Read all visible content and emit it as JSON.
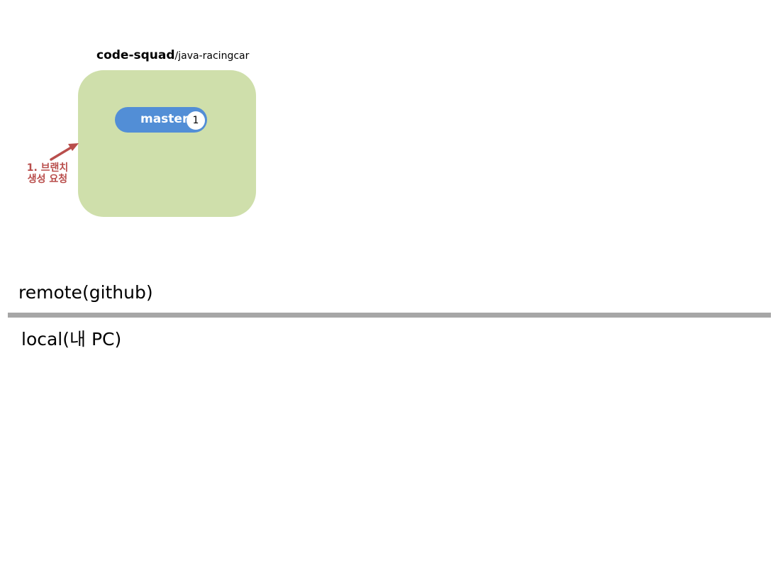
{
  "colors": {
    "repo_box": "#cfdfab",
    "branch_pill": "#528ed6",
    "annotation": "#b94e4c",
    "divider": "#a6a6a6"
  },
  "repo": {
    "owner": "code-squad",
    "separator": "/",
    "name": "java-racingcar",
    "branch": {
      "label": "master",
      "commit_count": "1"
    }
  },
  "annotation": {
    "line1": "1. 브랜치",
    "line2": "생성 요청"
  },
  "zones": {
    "remote": "remote(github)",
    "local": "local(내 PC)"
  }
}
